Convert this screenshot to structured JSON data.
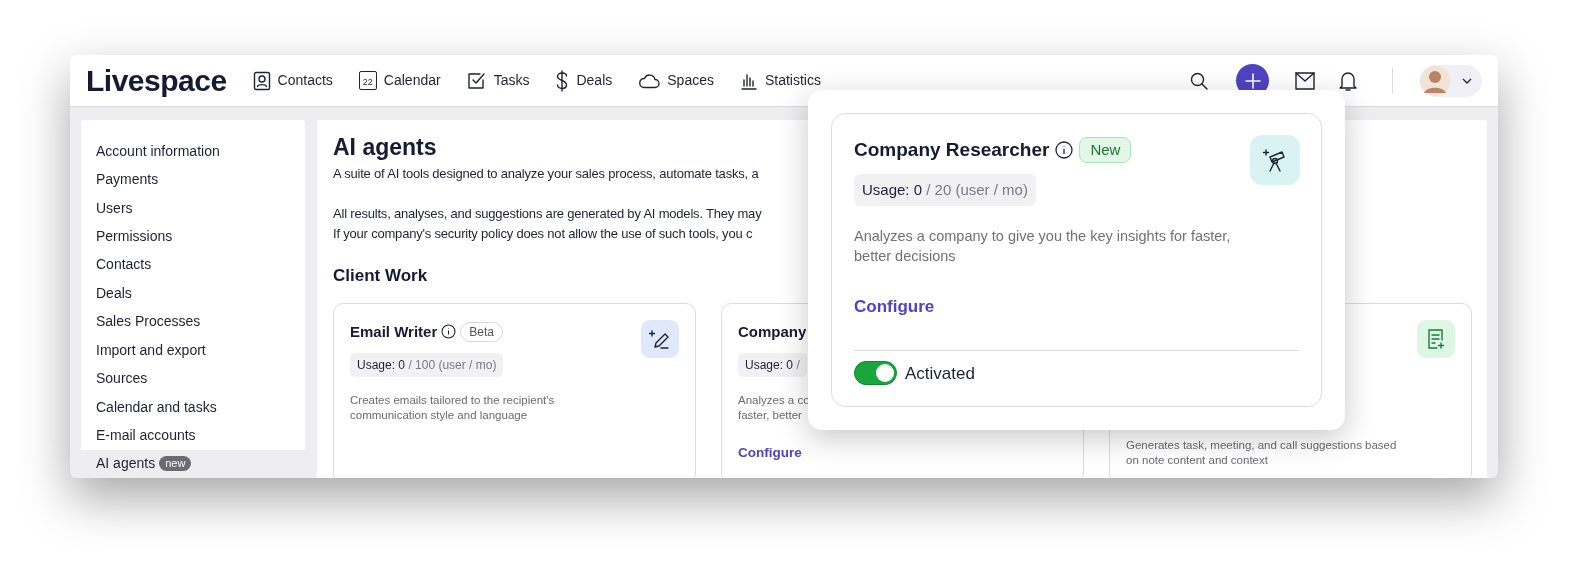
{
  "header": {
    "logo": "Livespace",
    "nav": [
      {
        "label": "Contacts"
      },
      {
        "label": "Calendar",
        "icon_text": "22"
      },
      {
        "label": "Tasks"
      },
      {
        "label": "Deals"
      },
      {
        "label": "Spaces"
      },
      {
        "label": "Statistics"
      }
    ]
  },
  "sidebar": {
    "items": [
      {
        "label": "Account information",
        "selected": false
      },
      {
        "label": "Payments",
        "selected": false
      },
      {
        "label": "Users",
        "selected": false
      },
      {
        "label": "Permissions",
        "selected": false
      },
      {
        "label": "Contacts",
        "selected": false
      },
      {
        "label": "Deals",
        "selected": false
      },
      {
        "label": "Sales Processes",
        "selected": false
      },
      {
        "label": "Import and export",
        "selected": false
      },
      {
        "label": "Sources",
        "selected": false
      },
      {
        "label": "Calendar and tasks",
        "selected": false
      },
      {
        "label": "E-mail accounts",
        "selected": false
      },
      {
        "label": "AI agents",
        "selected": true,
        "badge": "new"
      }
    ]
  },
  "main": {
    "title": "AI agents",
    "intro": [
      "A suite of AI tools designed to analyze your sales process, automate tasks, a",
      "All results, analyses, and suggestions are generated by AI models. They may",
      "If your company's security policy does not allow the use of such tools, you c"
    ],
    "section": "Client Work",
    "cards": [
      {
        "title": "Email Writer",
        "badge": "Beta",
        "usage_count": "Usage: 0",
        "usage_limit": "/ 100 (user / mo)",
        "description": [
          "Creates emails tailored to the recipient's",
          "communication style and language"
        ]
      },
      {
        "title": "Company",
        "usage_count": "Usage: 0",
        "usage_limit": "/",
        "description": [
          "Analyzes a co",
          "faster, better"
        ],
        "link": "Configure"
      },
      {
        "description": [
          "Generates task, meeting, and call suggestions based",
          "on note content and context"
        ]
      }
    ]
  },
  "popover": {
    "title": "Company Researcher",
    "badge": "New",
    "usage_count": "Usage: 0",
    "usage_limit": "/ 20 (user / mo)",
    "description": "Analyzes a company to give you the key insights for faster, better decisions",
    "link": "Configure",
    "toggle": {
      "label": "Activated",
      "on": true
    }
  }
}
